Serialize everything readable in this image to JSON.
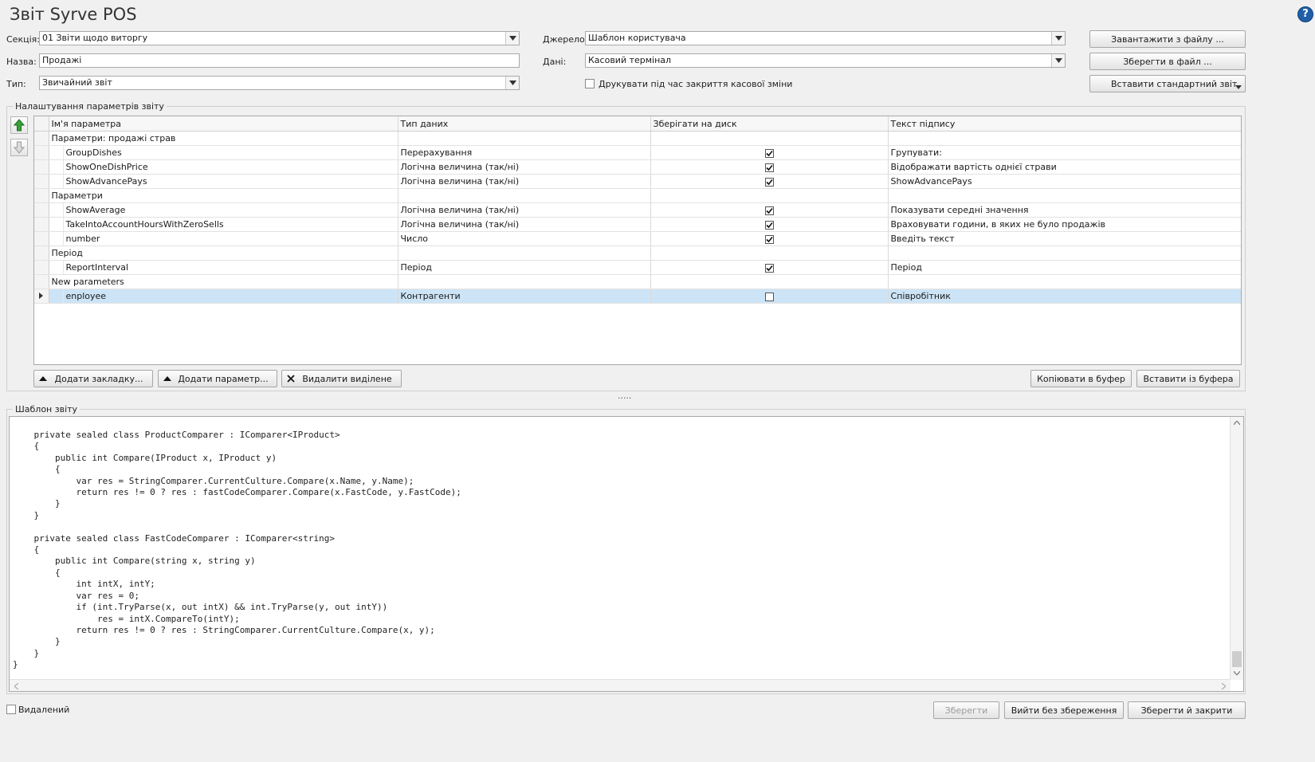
{
  "window": {
    "title": "Звіт Syrve POS",
    "help_label": "?"
  },
  "form": {
    "section": {
      "label": "Секція:",
      "value": "01 Звіти щодо виторгу"
    },
    "name": {
      "label": "Назва:",
      "value": "Продажі"
    },
    "type": {
      "label": "Тип:",
      "value": "Звичайний звіт"
    },
    "source": {
      "label": "Джерело:",
      "value": "Шаблон користувача"
    },
    "data": {
      "label": "Дані:",
      "value": "Касовий термінал"
    },
    "print_on_close": {
      "label": "Друкувати під час закриття касової зміни",
      "checked": false
    }
  },
  "right_buttons": {
    "load": "Завантажити з файлу ...",
    "save_file": "Зберегти в файл ...",
    "insert_standard": "Вставити стандартний звіт"
  },
  "params_group": {
    "title": "Налаштування параметрів звіту",
    "columns": [
      "Ім'я параметра",
      "Тип даних",
      "Зберігати на диск",
      "Текст підпису"
    ],
    "rows": [
      {
        "kind": "group",
        "name": "Параметри: продажі страв"
      },
      {
        "kind": "item",
        "name": "GroupDishes",
        "type": "Перерахування",
        "save": true,
        "caption": "Групувати:"
      },
      {
        "kind": "item",
        "name": "ShowOneDishPrice",
        "type": "Логічна величина (так/ні)",
        "save": true,
        "caption": "Відображати вартість однієї страви"
      },
      {
        "kind": "item",
        "name": "ShowAdvancePays",
        "type": "Логічна величина (так/ні)",
        "save": true,
        "caption": "ShowAdvancePays"
      },
      {
        "kind": "group",
        "name": "Параметри"
      },
      {
        "kind": "item",
        "name": "ShowAverage",
        "type": "Логічна величина (так/ні)",
        "save": true,
        "caption": "Показувати середні значення"
      },
      {
        "kind": "item",
        "name": "TakeIntoAccountHoursWithZeroSells",
        "type": "Логічна величина (так/ні)",
        "save": true,
        "caption": "Враховувати години, в яких не було продажів"
      },
      {
        "kind": "item",
        "name": "number",
        "type": "Число",
        "save": true,
        "caption": "Введіть текст"
      },
      {
        "kind": "group",
        "name": "Період"
      },
      {
        "kind": "item",
        "name": "ReportInterval",
        "type": "Період",
        "save": true,
        "caption": "Період"
      },
      {
        "kind": "group",
        "name": "New parameters"
      },
      {
        "kind": "item",
        "name": "enployee",
        "type": "Контрагенти",
        "save": false,
        "caption": "Співробітник",
        "selected": true
      }
    ],
    "buttons": {
      "add_tab": "Додати закладку...",
      "add_param": "Додати параметр...",
      "delete_selected": "Видалити виділене",
      "copy_buffer": "Копіювати в буфер",
      "paste_buffer": "Вставити із буфера"
    }
  },
  "splitter_label": ".....",
  "template_group": {
    "title": "Шаблон звіту",
    "code": "    private sealed class ProductComparer : IComparer<IProduct>\n    {\n        public int Compare(IProduct x, IProduct y)\n        {\n            var res = StringComparer.CurrentCulture.Compare(x.Name, y.Name);\n            return res != 0 ? res : fastCodeComparer.Compare(x.FastCode, y.FastCode);\n        }\n    }\n\n    private sealed class FastCodeComparer : IComparer<string>\n    {\n        public int Compare(string x, string y)\n        {\n            int intX, intY;\n            var res = 0;\n            if (int.TryParse(x, out intX) && int.TryParse(y, out intY))\n                res = intX.CompareTo(intY);\n            return res != 0 ? res : StringComparer.CurrentCulture.Compare(x, y);\n        }\n    }\n}"
  },
  "footer": {
    "deleted": {
      "label": "Видалений",
      "checked": false
    },
    "save": "Зберегти",
    "exit_no_save": "Вийти без збереження",
    "save_close": "Зберегти й закрити"
  }
}
